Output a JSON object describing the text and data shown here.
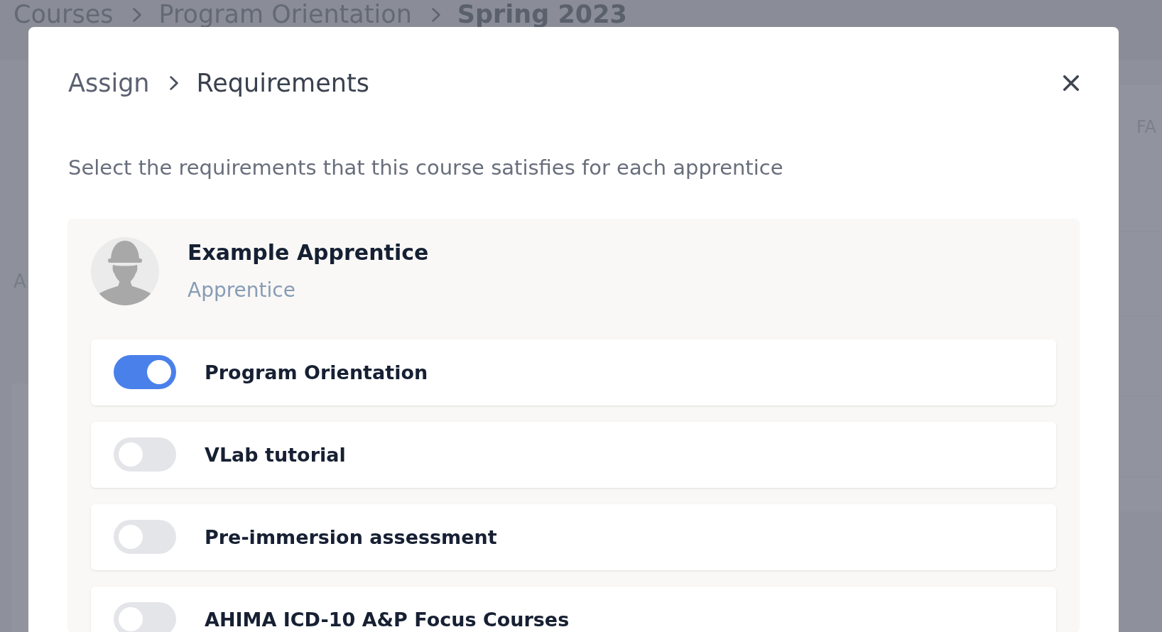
{
  "page": {
    "breadcrumb": [
      {
        "label": "Courses",
        "current": false
      },
      {
        "label": "Program Orientation",
        "current": false
      },
      {
        "label": "Spring 2023",
        "current": true
      }
    ],
    "left_column_text": "A",
    "right_column_header": "FA"
  },
  "modal": {
    "breadcrumb": [
      {
        "label": "Assign",
        "current": false
      },
      {
        "label": "Requirements",
        "current": true
      }
    ],
    "instructions": "Select the requirements that this course satisfies for each apprentice",
    "apprentices": [
      {
        "name": "Example Apprentice",
        "role": "Apprentice",
        "requirements": [
          {
            "label": "Program Orientation",
            "on": true
          },
          {
            "label": "VLab tutorial",
            "on": false
          },
          {
            "label": "Pre-immersion assessment",
            "on": false
          },
          {
            "label": "AHIMA ICD-10 A&P Focus Courses",
            "on": false
          }
        ]
      }
    ]
  }
}
